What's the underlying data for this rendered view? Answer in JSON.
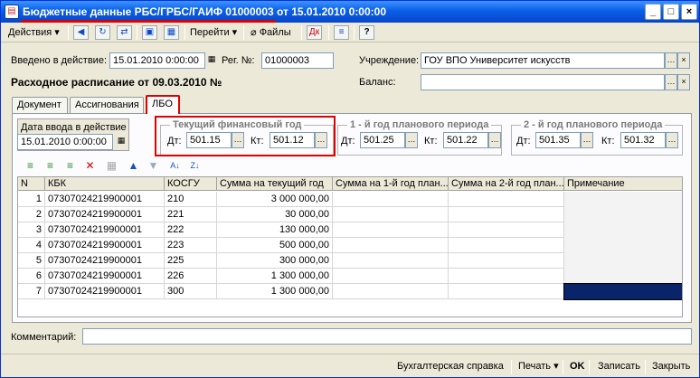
{
  "window": {
    "title": "Бюджетные данные РБС/ГРБС/ГАИФ 01000003 от 15.01.2010 0:00:00"
  },
  "title_buttons": {
    "min": "_",
    "max": "□",
    "close": "×"
  },
  "toolbar": {
    "actions": "Действия",
    "goto": "Перейти",
    "files": "Файлы"
  },
  "header": {
    "entered_label": "Введено в действие:",
    "entered_value": "15.01.2010 0:00:00",
    "reg_label": "Рег. №:",
    "reg_value": "01000003",
    "institution_label": "Учреждение:",
    "institution_value": "ГОУ ВПО Университет искусств",
    "schedule_title": "Расходное расписание от 09.03.2010 №",
    "balance_label": "Баланс:",
    "balance_value": ""
  },
  "tabs": [
    {
      "label": "Документ"
    },
    {
      "label": "Ассигнования"
    },
    {
      "label": "ЛБО"
    }
  ],
  "date_group": {
    "title": "Дата ввода в действие",
    "value": "15.01.2010 0:00:00"
  },
  "periods": [
    {
      "title": "Текущий финансовый год",
      "dt_label": "Дт:",
      "dt": "501.15",
      "kt_label": "Кт:",
      "kt": "501.12"
    },
    {
      "title": "1 - й год планового периода",
      "dt_label": "Дт:",
      "dt": "501.25",
      "kt_label": "Кт:",
      "kt": "501.22"
    },
    {
      "title": "2 - й год планового периода",
      "dt_label": "Дт:",
      "dt": "501.35",
      "kt_label": "Кт:",
      "kt": "501.32"
    }
  ],
  "table": {
    "headers": [
      "N",
      "КБК",
      "КОСГУ",
      "Сумма на текущий год",
      "Сумма на 1-й год план...",
      "Сумма на 2-й год план...",
      "Примечание"
    ],
    "rows": [
      [
        "1",
        "07307024219900001",
        "210",
        "3 000 000,00"
      ],
      [
        "2",
        "07307024219900001",
        "221",
        "30 000,00"
      ],
      [
        "3",
        "07307024219900001",
        "222",
        "130 000,00"
      ],
      [
        "4",
        "07307024219900001",
        "223",
        "500 000,00"
      ],
      [
        "5",
        "07307024219900001",
        "225",
        "300 000,00"
      ],
      [
        "6",
        "07307024219900001",
        "226",
        "1 300 000,00"
      ],
      [
        "7",
        "07307024219900001",
        "300",
        "1 300 000,00"
      ]
    ]
  },
  "comment": {
    "label": "Комментарий:",
    "value": ""
  },
  "footer": {
    "reference": "Бухгалтерская справка",
    "print": "Печать",
    "ok": "OK",
    "save": "Записать",
    "close": "Закрыть"
  },
  "colors": {
    "accent_red": "#e00000",
    "selection": "#0a246a"
  }
}
